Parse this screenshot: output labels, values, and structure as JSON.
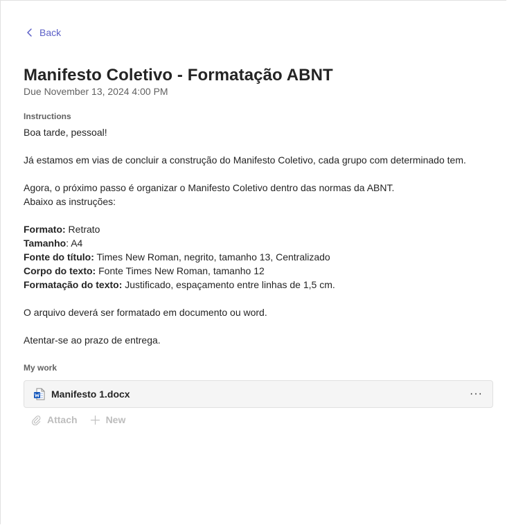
{
  "nav": {
    "back_label": "Back"
  },
  "assignment": {
    "title": "Manifesto Coletivo - Formatação ABNT",
    "due": "Due November 13, 2024 4:00 PM"
  },
  "instructions": {
    "label": "Instructions",
    "greeting": "Boa tarde, pessoal!",
    "para1": "Já estamos em vias de concluir a construção do Manifesto Coletivo, cada grupo com determinado tem.",
    "para2_line1": "Agora, o próximo passo é organizar o Manifesto Coletivo dentro das normas da ABNT.",
    "para2_line2": "Abaixo as instruções:",
    "specs": [
      {
        "key": "Formato:",
        "value": " Retrato"
      },
      {
        "key": "Tamanho",
        "value": ": A4"
      },
      {
        "key": "Fonte do título:",
        "value": " Times New Roman, negrito, tamanho 13, Centralizado"
      },
      {
        "key": "Corpo do texto:",
        "value": " Fonte Times New Roman, tamanho 12"
      },
      {
        "key": "Formatação do texto:",
        "value": " Justificado, espaçamento entre linhas de 1,5 cm."
      }
    ],
    "para3": "O arquivo deverá ser formatado em documento ou word.",
    "para4": "Atentar-se ao prazo de entrega."
  },
  "my_work": {
    "label": "My work",
    "file_name": "Manifesto 1.docx",
    "more_label": "···",
    "attach_label": "Attach",
    "new_label": "New"
  },
  "colors": {
    "accent": "#5b5fc7",
    "word_blue": "#185abd",
    "disabled": "#bdbdbd"
  },
  "icons": [
    "chevron-left-icon",
    "word-file-icon",
    "more-icon",
    "paperclip-icon",
    "plus-icon"
  ]
}
